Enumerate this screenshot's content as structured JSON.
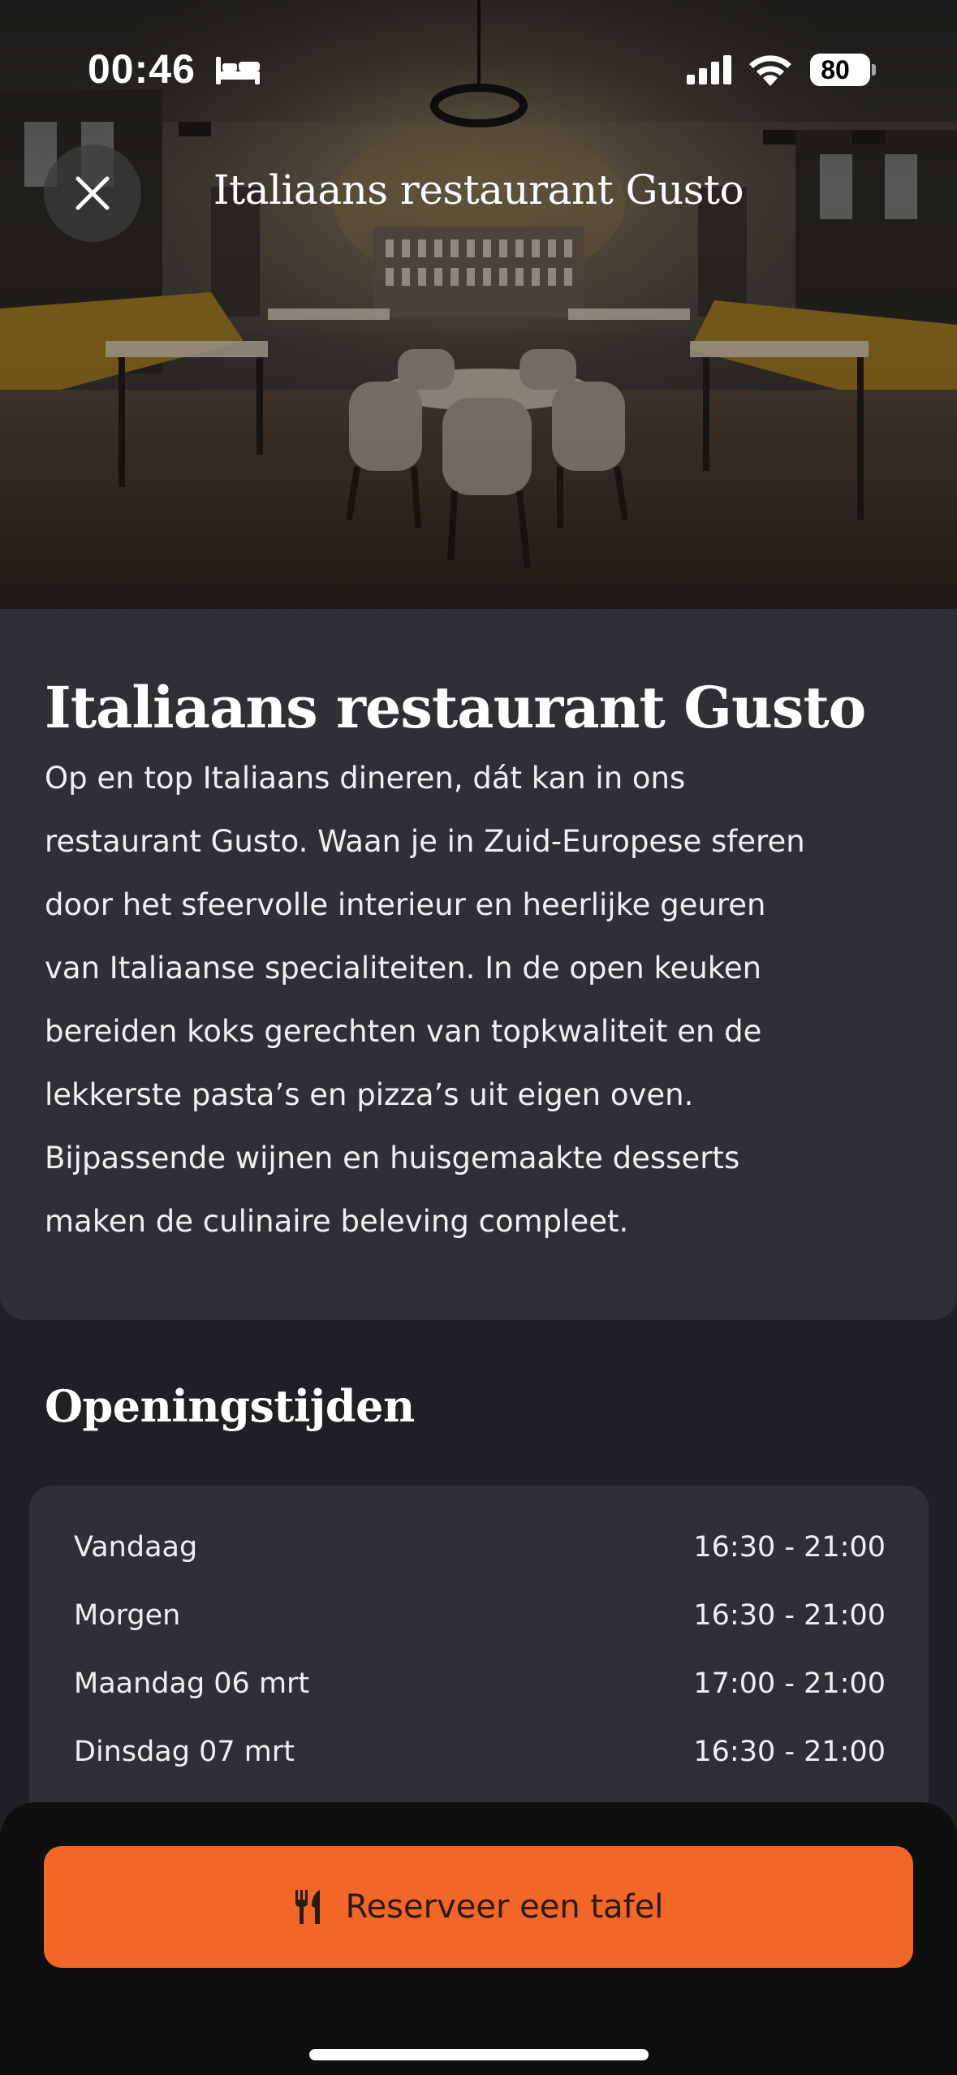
{
  "status_bar": {
    "time": "00:46",
    "battery": "80",
    "icons": [
      "bed-icon",
      "signal-icon",
      "wifi-icon",
      "battery-icon"
    ]
  },
  "header": {
    "title": "Italiaans restaurant Gusto",
    "close_icon": "close-icon"
  },
  "info": {
    "title": "Italiaans restaurant Gusto",
    "description_lines": [
      "Op en top Italiaans dineren, dát kan in ons",
      "restaurant Gusto. Waan je in Zuid-Europese sferen",
      "door het sfeervolle interieur en heerlijke geuren",
      "van Italiaanse specialiteiten. In de open keuken",
      "bereiden koks gerechten van topkwaliteit en de",
      "lekkerste pasta’s en pizza’s uit eigen oven.",
      "Bijpassende wijnen en huisgemaakte desserts",
      "maken de culinaire beleving compleet."
    ]
  },
  "opening_hours": {
    "heading": "Openingstijden",
    "rows": [
      {
        "day": "Vandaag",
        "time": "16:30 - 21:00"
      },
      {
        "day": "Morgen",
        "time": "16:30 - 21:00"
      },
      {
        "day": "Maandag 06 mrt",
        "time": "17:00 - 21:00"
      },
      {
        "day": "Dinsdag 07 mrt",
        "time": "16:30 - 21:00"
      }
    ]
  },
  "cta": {
    "label": "Reserveer een tafel",
    "icon": "cutlery-icon",
    "color": "#f26628"
  },
  "colors": {
    "background": "#1f2023",
    "card": "#2e3034",
    "bottom_bar": "#0f0f10"
  }
}
